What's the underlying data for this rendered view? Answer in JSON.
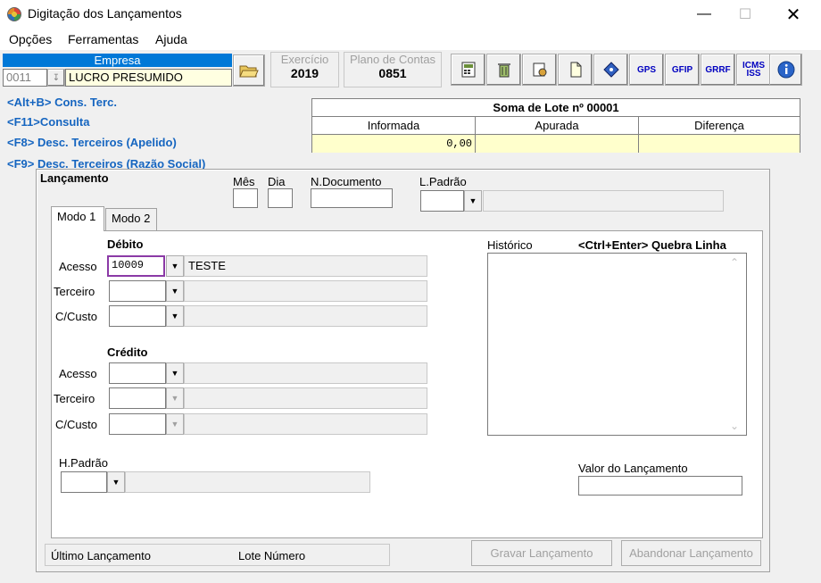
{
  "window": {
    "title": "Digitação dos Lançamentos"
  },
  "menu": {
    "opcoes": "Opções",
    "ferramentas": "Ferramentas",
    "ajuda": "Ajuda"
  },
  "empresa": {
    "header": "Empresa",
    "code": "0011",
    "name": "LUCRO PRESUMIDO"
  },
  "exercicio": {
    "label": "Exercício",
    "value": "2019"
  },
  "plano": {
    "label": "Plano de Contas",
    "value": "0851"
  },
  "toolbar": {
    "gps": "GPS",
    "gfip": "GFIP",
    "grrf": "GRRF",
    "icms_iss_1": "ICMS",
    "icms_iss_2": "ISS"
  },
  "shortcuts": [
    "<Alt+B> Cons. Terc.",
    "<F11>Consulta",
    "<F8> Desc. Terceiros (Apelido)",
    "<F9> Desc. Terceiros (Razão Social)"
  ],
  "lote": {
    "title": "Soma de Lote nº 00001",
    "col_informada": "Informada",
    "col_apurada": "Apurada",
    "col_diferenca": "Diferença",
    "informada_value": "0,00",
    "apurada_value": "",
    "diferenca_value": ""
  },
  "lancamento": {
    "title": "Lançamento",
    "mes": "Mês",
    "dia": "Dia",
    "n_documento": "N.Documento",
    "l_padrao": "L.Padrão"
  },
  "tabs": [
    "Modo 1",
    "Modo 2"
  ],
  "debito": {
    "title": "Débito",
    "acesso_label": "Acesso",
    "acesso_value": "10009",
    "acesso_desc": "TESTE",
    "terceiro_label": "Terceiro",
    "ccusto_label": "C/Custo"
  },
  "credito": {
    "title": "Crédito",
    "acesso_label": "Acesso",
    "terceiro_label": "Terceiro",
    "ccusto_label": "C/Custo"
  },
  "historico": {
    "label": "Histórico",
    "hint": "<Ctrl+Enter> Quebra Linha"
  },
  "hpadrao": {
    "label": "H.Padrão"
  },
  "valor": {
    "label": "Valor do Lançamento"
  },
  "status": {
    "ultimo": "Último Lançamento",
    "lote_numero": "Lote Número"
  },
  "buttons": {
    "gravar": "Gravar Lançamento",
    "abandonar": "Abandonar Lançamento"
  }
}
